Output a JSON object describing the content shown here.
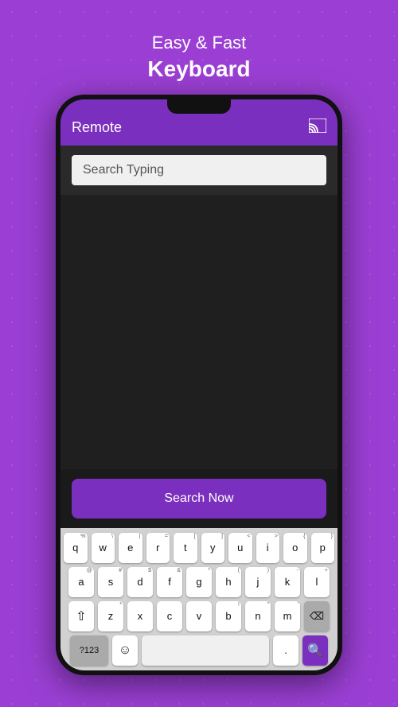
{
  "header": {
    "subtitle": "Easy & Fast",
    "title": "Keyboard"
  },
  "toolbar": {
    "app_name": "Remote",
    "cast_icon": "⬡"
  },
  "search": {
    "placeholder": "Search Typing",
    "button_label": "Search Now"
  },
  "keyboard": {
    "row1": [
      "q",
      "w",
      "e",
      "r",
      "t",
      "y",
      "u",
      "i",
      "o",
      "p"
    ],
    "row1_symbols": [
      "%",
      null,
      null,
      null,
      "=",
      "[",
      "]",
      "<",
      ">",
      "{",
      "}"
    ],
    "row2": [
      "a",
      "s",
      "d",
      "f",
      "g",
      "h",
      "j",
      "k",
      "l"
    ],
    "row2_symbols": [
      "@",
      "#",
      "$",
      "&",
      "*",
      "(",
      ")",
      "-",
      "+"
    ],
    "row3": [
      "z",
      "x",
      "c",
      "v",
      "b",
      "n",
      "m"
    ],
    "row3_symbols": [
      null,
      null,
      null,
      null,
      "!",
      "\"",
      "'"
    ],
    "special_keys": {
      "numbers": "?123",
      "comma": ",",
      "period": ".",
      "delete": "⌫",
      "shift": "⇧"
    }
  }
}
